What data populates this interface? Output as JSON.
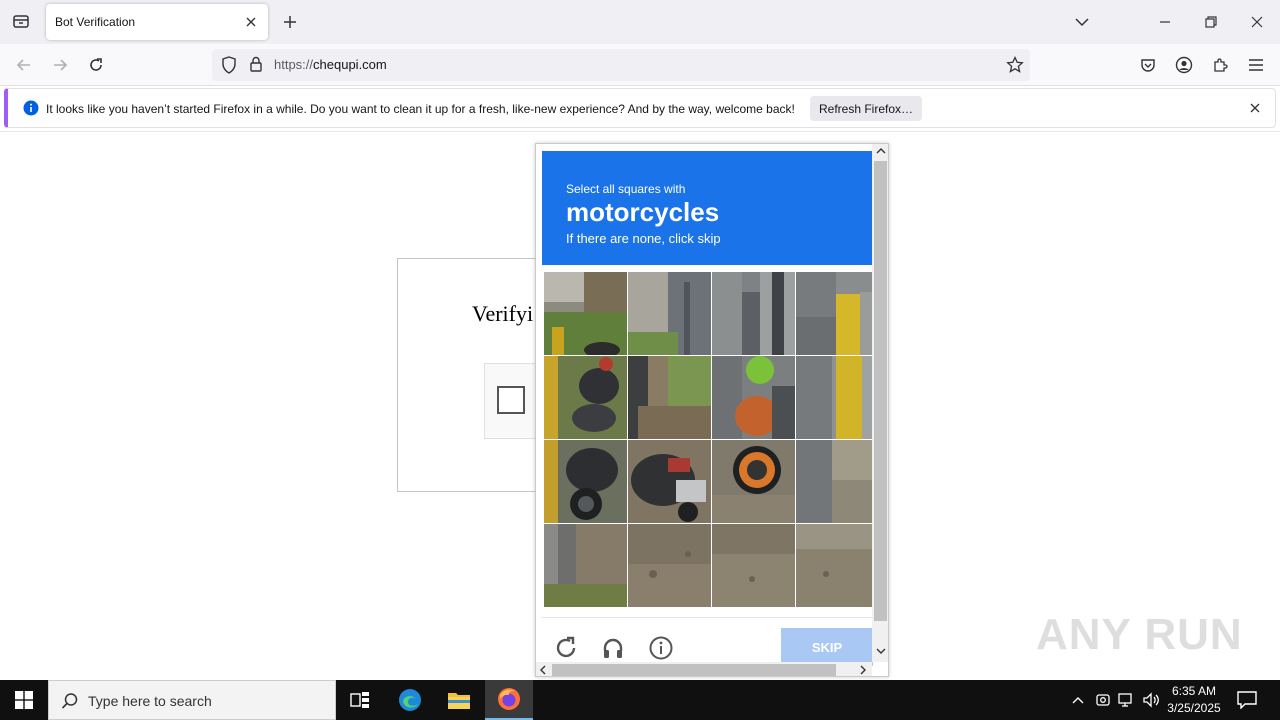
{
  "browser": {
    "tab_title": "Bot Verification",
    "url_scheme": "https://",
    "url_host": "chequpi.com"
  },
  "notification": {
    "message": "It looks like you haven’t started Firefox in a while. Do you want to clean it up for a fresh, like-new experience? And by the way, welcome back!",
    "button_label": "Refresh Firefox…"
  },
  "page": {
    "verify_title": "Verifyi"
  },
  "captcha": {
    "instruction_small": "Select all squares with",
    "target": "motorcycles",
    "instruction_sub": "If there are none, click skip",
    "skip_label": "SKIP",
    "accent_color": "#1a73e8"
  },
  "watermark": "ANY RUN",
  "taskbar": {
    "search_placeholder": "Type here to search",
    "time": "6:35 AM",
    "date": "3/25/2025"
  }
}
